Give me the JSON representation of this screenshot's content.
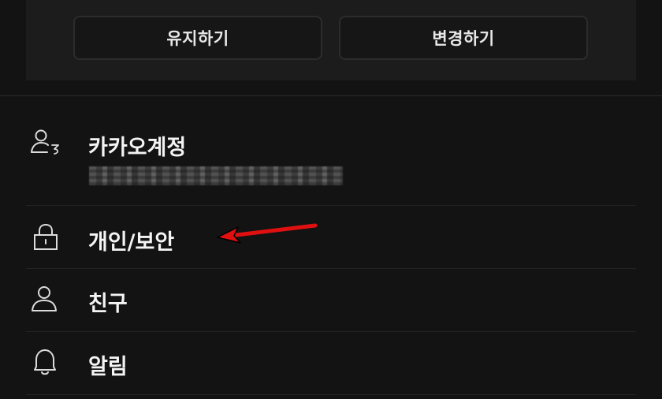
{
  "top_card": {
    "keep_label": "유지하기",
    "change_label": "변경하기"
  },
  "menu": {
    "items": [
      {
        "label": "카카오계정",
        "icon": "account-icon"
      },
      {
        "label": "개인/보안",
        "icon": "lock-icon"
      },
      {
        "label": "친구",
        "icon": "person-icon"
      },
      {
        "label": "알림",
        "icon": "bell-icon"
      }
    ]
  },
  "colors": {
    "background": "#131313",
    "card": "#1c1c1c",
    "arrow": "#e01010"
  }
}
